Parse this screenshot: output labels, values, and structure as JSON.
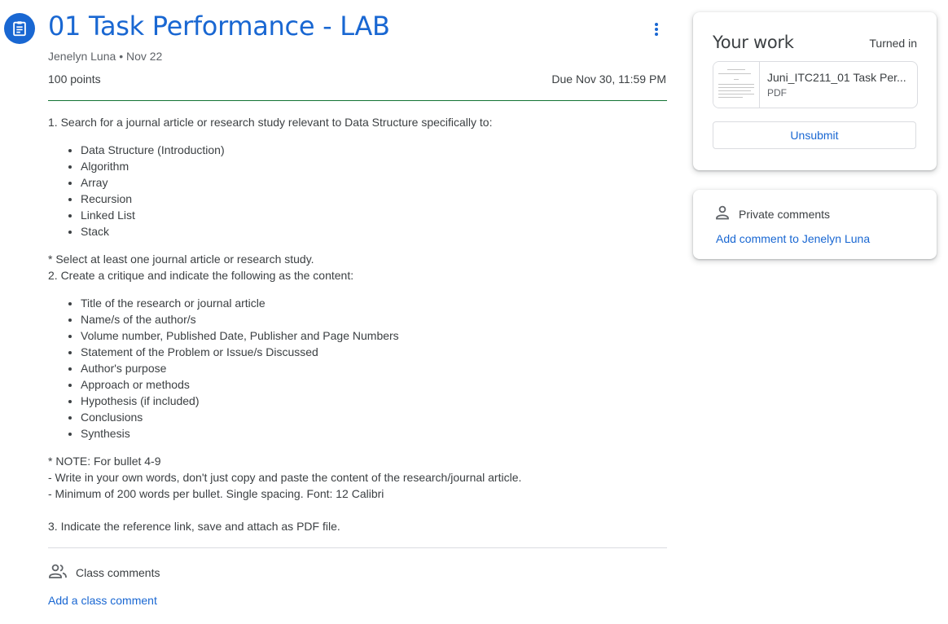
{
  "assignment": {
    "icon": "assignment-icon",
    "title": "01 Task Performance - LAB",
    "author": "Jenelyn Luna",
    "posted": "Nov 22",
    "points": "100 points",
    "due": "Due Nov 30, 11:59 PM",
    "more_icon": "more-vert-icon",
    "accent_color": "#1967d2"
  },
  "instructions": {
    "step1": "1. Search for a journal article or research study relevant to Data Structure specifically to:",
    "topics": [
      "Data Structure (Introduction)",
      "Algorithm",
      "Array",
      "Recursion",
      "Linked List",
      "Stack"
    ],
    "select_note": "* Select at least one journal article or research study.",
    "step2": "2. Create a critique and indicate the following as the content:",
    "critique_items": [
      "Title of the research or journal article",
      "Name/s of the author/s",
      "Volume number, Published Date, Publisher and Page Numbers",
      "Statement of the Problem or Issue/s Discussed",
      "Author's purpose",
      "Approach or methods",
      "Hypothesis (if included)",
      "Conclusions",
      "Synthesis"
    ],
    "note_title": "* NOTE: For bullet 4-9",
    "note_line1": "- Write in your own words, don't just copy and paste the content of the research/journal article.",
    "note_line2": "- Minimum of 200 words per bullet. Single spacing. Font: 12 Calibri",
    "step3": "3. Indicate the reference link, save and attach as PDF file."
  },
  "class_comments": {
    "icon": "people-icon",
    "label": "Class comments",
    "add_label": "Add a class comment"
  },
  "your_work": {
    "title": "Your work",
    "status": "Turned in",
    "attachment": {
      "name": "Juni_ITC211_01 Task Per...",
      "type": "PDF"
    },
    "unsubmit_label": "Unsubmit"
  },
  "private_comments": {
    "icon": "person-icon",
    "label": "Private comments",
    "add_label": "Add comment to Jenelyn Luna"
  }
}
